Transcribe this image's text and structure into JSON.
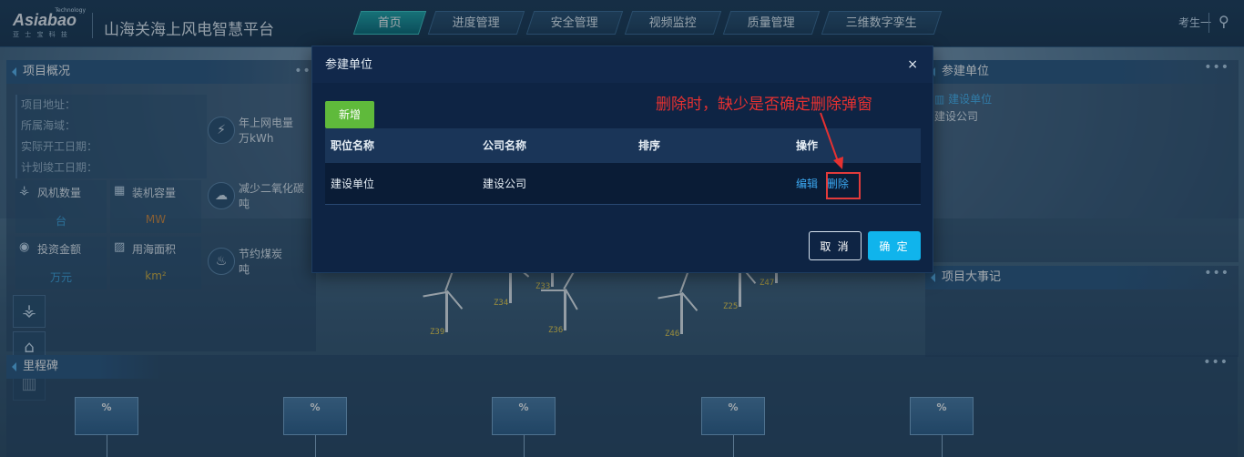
{
  "header": {
    "logo_brand": "Asiabao",
    "logo_sub": "亚 士 宝 科 技",
    "logo_tiny": "Technology",
    "title": "山海关海上风电智慧平台",
    "nav": [
      "首页",
      "进度管理",
      "安全管理",
      "视频监控",
      "质量管理",
      "三维数字孪生"
    ],
    "active_nav": "首页",
    "user": "考生一"
  },
  "left_panel": {
    "title": "项目概况",
    "info": [
      "项目地址：",
      "所属海域：",
      "实际开工日期：",
      "计划竣工日期："
    ],
    "stats": [
      {
        "icon": "turbine-icon",
        "label": "风机数量",
        "value": "台"
      },
      {
        "icon": "capacity-icon",
        "label": "装机容量",
        "value": "MW"
      },
      {
        "icon": "investment-icon",
        "label": "投资金额",
        "value": "万元"
      },
      {
        "icon": "area-icon",
        "label": "用海面积",
        "value": "km²"
      }
    ],
    "side_metrics": [
      {
        "icon": "lightning-icon",
        "line1": "年上网电量",
        "line2": "万kWh"
      },
      {
        "icon": "co2-icon",
        "line1": "减少二氧化碳",
        "line2": "吨"
      },
      {
        "icon": "fire-icon",
        "line1": "节约煤炭",
        "line2": "吨"
      }
    ]
  },
  "right_panel": {
    "title": "参建单位",
    "item_head": "建设单位",
    "item_sub": "建设公司"
  },
  "events_panel": {
    "title": "项目大事记"
  },
  "milestone": {
    "title": "里程碑",
    "boxes": [
      "%",
      "%",
      "%",
      "%",
      "%"
    ]
  },
  "turbines": [
    "Z39",
    "Z34",
    "Z33",
    "Z36",
    "Z46",
    "Z25",
    "Z47"
  ],
  "modal": {
    "title": "参建单位",
    "close": "×",
    "add_label": "新增",
    "columns": [
      "职位名称",
      "公司名称",
      "排序",
      "操作"
    ],
    "rows": [
      {
        "position": "建设单位",
        "company": "建设公司",
        "order": "",
        "edit": "编辑",
        "delete": "删除"
      }
    ],
    "cancel_label": "取 消",
    "ok_label": "确 定"
  },
  "annotation": {
    "text": "删除时，缺少是否确定删除弹窗",
    "color": "#e53131"
  }
}
